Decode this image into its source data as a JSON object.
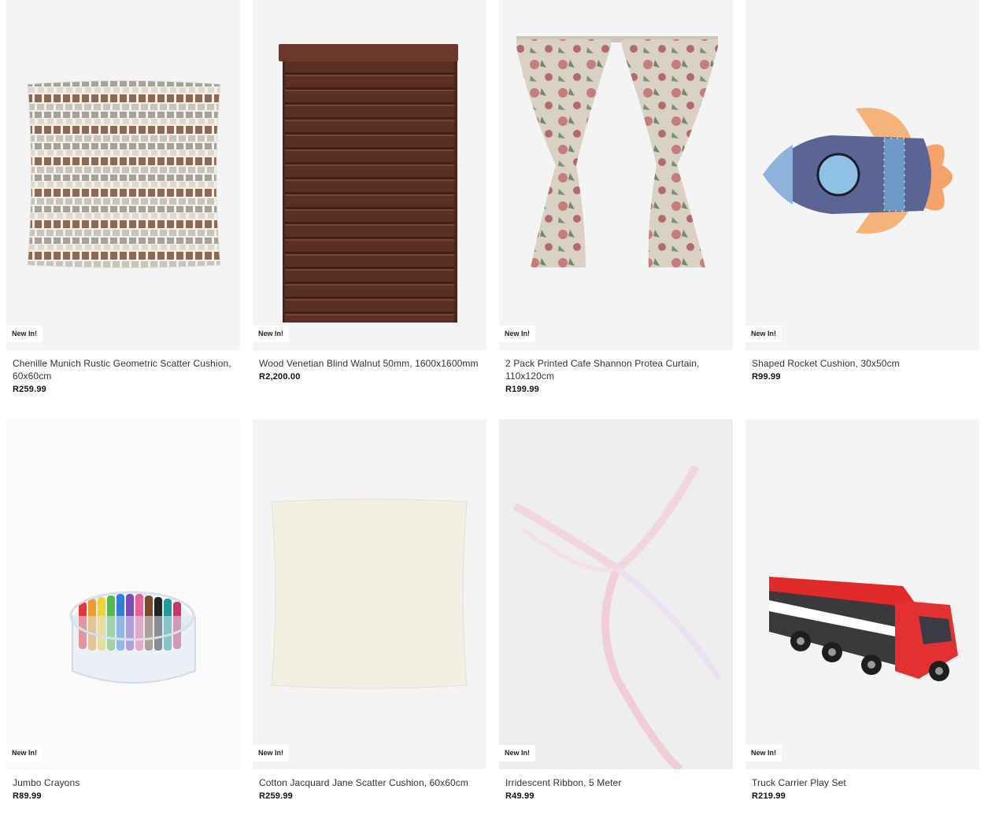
{
  "products": [
    {
      "badge": "New In!",
      "title": "Chenille Munich Rustic Geometric Scatter Cushion, 60x60cm",
      "price": "R259.99",
      "image": "geometric-cushion-image"
    },
    {
      "badge": "New In!",
      "title": "Wood Venetian Blind Walnut 50mm, 1600x1600mm",
      "price": "R2,200.00",
      "image": "venetian-blind-image"
    },
    {
      "badge": "New In!",
      "title": "2 Pack Printed Cafe Shannon Protea Curtain, 110x120cm",
      "price": "R199.99",
      "image": "protea-curtain-image"
    },
    {
      "badge": "New In!",
      "title": "Shaped Rocket Cushion, 30x50cm",
      "price": "R99.99",
      "image": "rocket-cushion-image"
    },
    {
      "badge": "New In!",
      "title": "Jumbo Crayons",
      "price": "R89.99",
      "image": "crayons-tub-image"
    },
    {
      "badge": "New In!",
      "title": "Cotton Jacquard Jane Scatter Cushion, 60x60cm",
      "price": "R259.99",
      "image": "cream-cushion-image"
    },
    {
      "badge": "New In!",
      "title": "Irridescent Ribbon, 5 Meter",
      "price": "R49.99",
      "image": "ribbon-image"
    },
    {
      "badge": "New In!",
      "title": "Truck Carrier Play Set",
      "price": "R219.99",
      "image": "truck-toy-image"
    }
  ]
}
